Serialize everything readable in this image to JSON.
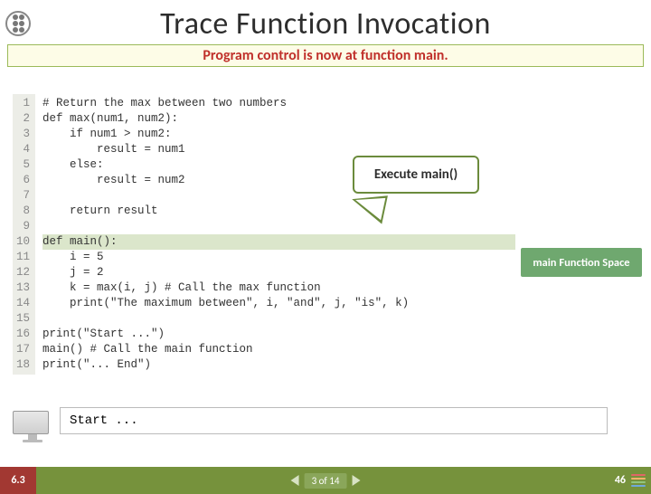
{
  "title": "Trace Function Invocation",
  "banner": "Program control is now at function main.",
  "code": {
    "line_numbers": "1\n2\n3\n4\n5\n6\n7\n8\n9\n10\n11\n12\n13\n14\n15\n16\n17\n18",
    "l1": "# Return the max between two numbers",
    "l2": "def max(num1, num2):",
    "l3": "    if num1 > num2:",
    "l4": "        result = num1",
    "l5": "    else:",
    "l6": "        result = num2",
    "l7": "",
    "l8": "    return result",
    "l9": "",
    "l10": "def main():",
    "l11": "    i = 5",
    "l12": "    j = 2",
    "l13": "    k = max(i, j) # Call the max function",
    "l14": "    print(\"The maximum between\", i, \"and\", j, \"is\", k)",
    "l15": "",
    "l16": "print(\"Start ...\")",
    "l17": "main() # Call the main function",
    "l18": "print(\"... End\")"
  },
  "callout": "Execute main()",
  "fn_space": "main Function Space",
  "output": "Start ...",
  "footer": {
    "chapter": "6.3",
    "position": "3 of 14",
    "page": "46"
  }
}
